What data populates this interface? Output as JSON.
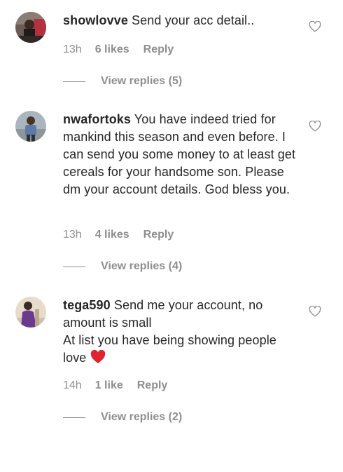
{
  "comments": [
    {
      "username": "showlovve",
      "text": "Send your acc detail..",
      "time": "13h",
      "likes": "6 likes",
      "reply_label": "Reply",
      "view_replies": "View replies (5)"
    },
    {
      "username": "nwafortoks",
      "text": "You have indeed tried for mankind this season and even before. I can send you some money to at least get cereals for your handsome son. Please dm your account details. God bless you.",
      "time": "13h",
      "likes": "4 likes",
      "reply_label": "Reply",
      "view_replies": "View replies (4)"
    },
    {
      "username": "tega590",
      "text_line1": "Send me your account, no amount is small",
      "text_line2": "At list you have being showing people love",
      "time": "14h",
      "likes": "1 like",
      "reply_label": "Reply",
      "view_replies": "View replies (2)"
    }
  ],
  "icons": {
    "like": "heart-outline-icon",
    "emoji": "red-heart-emoji"
  },
  "colors": {
    "text": "#262626",
    "muted": "#8e8e8e",
    "emoji_heart": "#e0232e"
  }
}
